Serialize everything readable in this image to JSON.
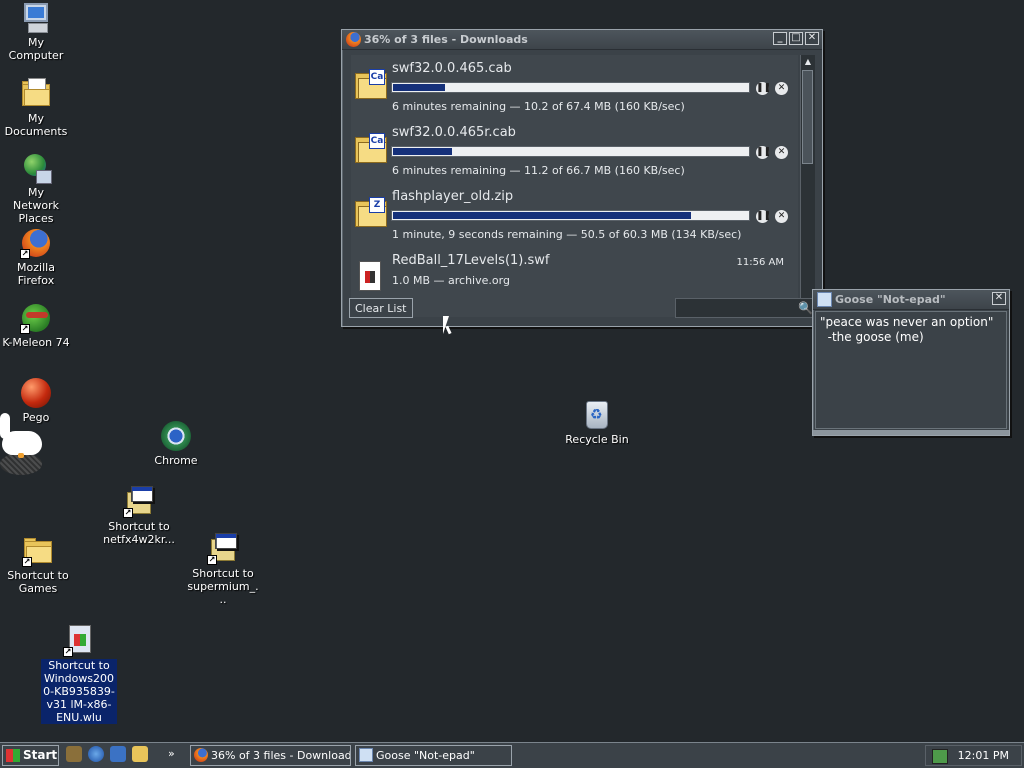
{
  "desktop": {
    "icons": [
      {
        "label": "My Computer",
        "icon": "computer-icon"
      },
      {
        "label": "My Documents",
        "icon": "documents-folder-icon"
      },
      {
        "label": "My Network Places",
        "icon": "network-places-icon"
      },
      {
        "label": "Mozilla Firefox",
        "icon": "firefox-icon"
      },
      {
        "label": "K-Meleon 74",
        "icon": "k-meleon-icon"
      },
      {
        "label": "Pego",
        "icon": "pego-icon"
      },
      {
        "label": "Chrome",
        "icon": "chrome-icon"
      },
      {
        "label": "Shortcut to netfx4w2kr...",
        "icon": "installer-icon"
      },
      {
        "label": "Shortcut to Games",
        "icon": "folder-icon"
      },
      {
        "label": "Shortcut to supermium_...",
        "icon": "installer-icon"
      },
      {
        "label": "Shortcut to Windows2000-KB935839-v31 lM-x86-ENU.wlu",
        "icon": "update-file-icon"
      },
      {
        "label": "Recycle Bin",
        "icon": "recycle-bin-icon"
      }
    ]
  },
  "downloads_window": {
    "title": "36% of 3 files - Downloads",
    "items": [
      {
        "name": "swf32.0.0.465.cab",
        "progress": 0.15,
        "status": "6 minutes remaining — 10.2 of 67.4 MB (160 KB/sec)",
        "badge": "Ca"
      },
      {
        "name": "swf32.0.0.465r.cab",
        "progress": 0.17,
        "status": "6 minutes remaining — 11.2 of 66.7 MB (160 KB/sec)",
        "badge": "Ca"
      },
      {
        "name": "flashplayer_old.zip",
        "progress": 0.84,
        "status": "1 minute, 9 seconds remaining — 50.5 of 60.3 MB (134 KB/sec)",
        "badge": "Z"
      },
      {
        "name": "RedBall_17Levels(1).swf",
        "status": "1.0 MB — archive.org",
        "time": "11:56 AM"
      }
    ],
    "clear_list_label": "Clear List",
    "search_placeholder": ""
  },
  "notepad_window": {
    "title": "Goose \"Not-epad\"",
    "text": "\"peace was never an option\"\n  -the goose (me)"
  },
  "taskbar": {
    "start_label": "Start",
    "overflow_label": "»",
    "tasks": [
      {
        "label": "36% of 3 files - Downloads"
      },
      {
        "label": "Goose \"Not-epad\""
      }
    ],
    "clock": "12:01 PM"
  },
  "colors": {
    "desktop_bg": "#23282c",
    "progress_fill": "#15307a",
    "selection": "#0a246a"
  }
}
